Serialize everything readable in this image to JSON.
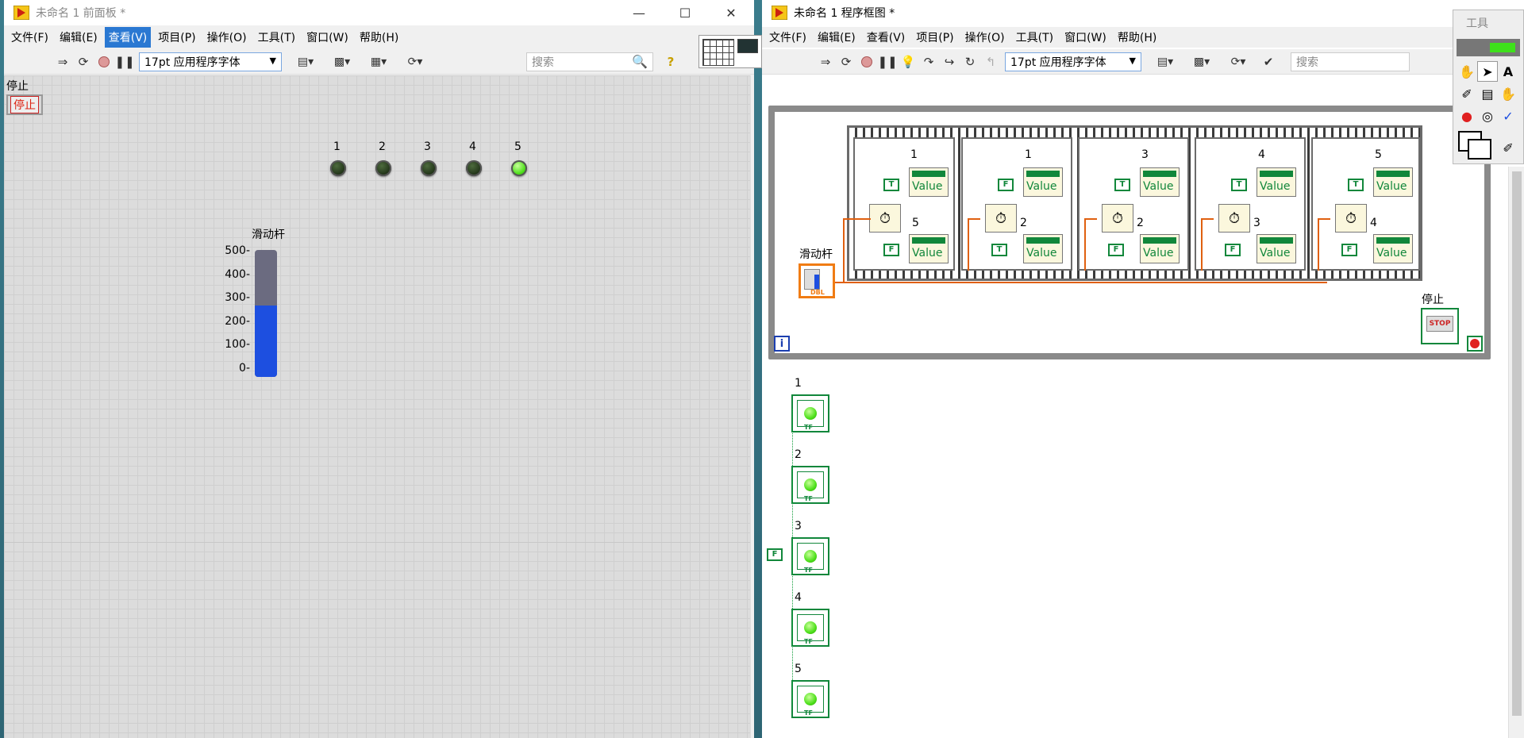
{
  "front_panel": {
    "title": "未命名 1 前面板 *",
    "menus": [
      "文件(F)",
      "编辑(E)",
      "查看(V)",
      "项目(P)",
      "操作(O)",
      "工具(T)",
      "窗口(W)",
      "帮助(H)"
    ],
    "active_menu": "查看(V)",
    "font_select": "17pt 应用程序字体",
    "search_placeholder": "搜索",
    "stop_label": "停止",
    "stop_button": "停止",
    "led_labels": [
      "1",
      "2",
      "3",
      "4",
      "5"
    ],
    "led_on": [
      false,
      false,
      false,
      false,
      true
    ],
    "slider_label": "滑动杆",
    "slider_ticks": [
      "500-",
      "400-",
      "300-",
      "200-",
      "100-",
      "0-"
    ],
    "slider_value": 280,
    "slider_max": 500
  },
  "block_diagram": {
    "title": "未命名 1 程序框图 *",
    "menus": [
      "文件(F)",
      "编辑(E)",
      "查看(V)",
      "项目(P)",
      "操作(O)",
      "工具(T)",
      "窗口(W)",
      "帮助(H)"
    ],
    "font_select": "17pt 应用程序字体",
    "search_placeholder": "搜索",
    "slider_terminal_label": "滑动杆",
    "slider_terminal_type": "DBL",
    "stop_terminal_label": "停止",
    "stop_terminal_text": "STOP",
    "iteration_label": "i",
    "frames": [
      {
        "top_label": "1",
        "top_const": "T",
        "bottom_label": "5",
        "bottom_const": "F"
      },
      {
        "top_label": "1",
        "top_const": "F",
        "bottom_label": "2",
        "bottom_const": "T"
      },
      {
        "top_label": "3",
        "top_const": "T",
        "bottom_label": "2",
        "bottom_const": "F"
      },
      {
        "top_label": "4",
        "top_const": "T",
        "bottom_label": "3",
        "bottom_const": "F"
      },
      {
        "top_label": "5",
        "top_const": "T",
        "bottom_label": "4",
        "bottom_const": "F"
      }
    ],
    "value_text": "Value",
    "indicator_labels": [
      "1",
      "2",
      "3",
      "4",
      "5"
    ],
    "false_const": "F",
    "tools_palette_title": "工具"
  }
}
